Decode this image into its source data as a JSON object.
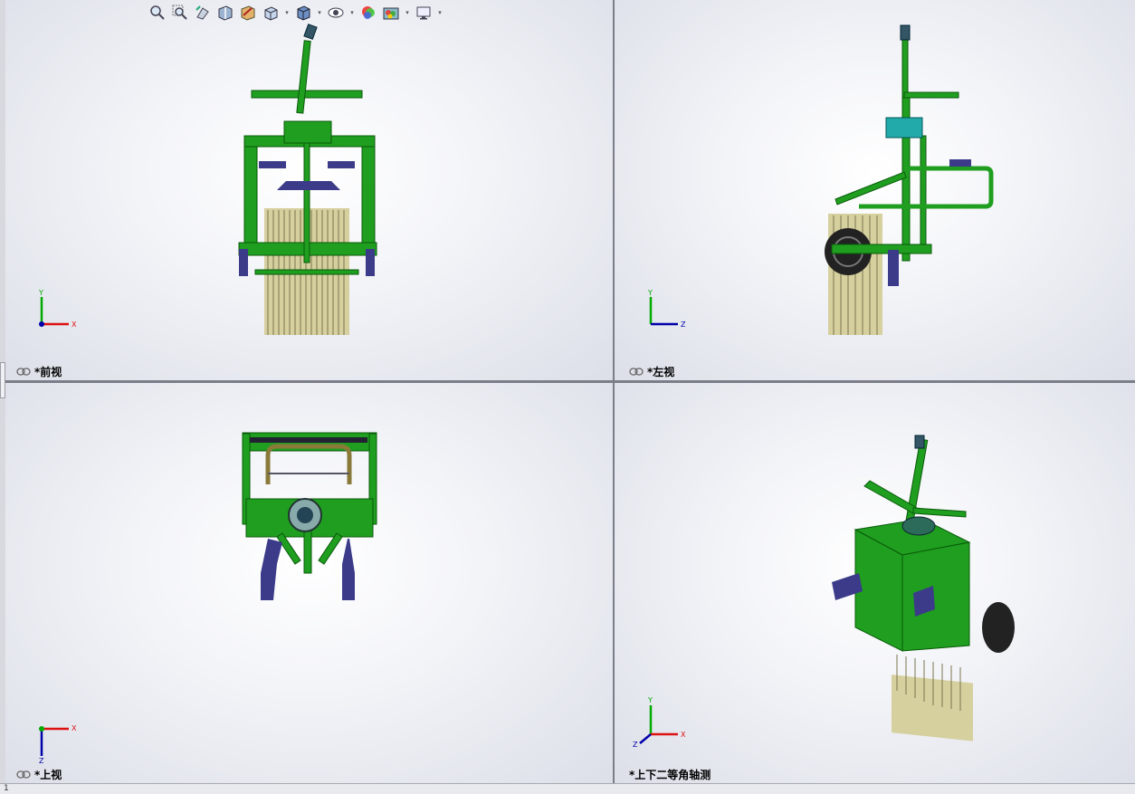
{
  "app": {
    "name": "SolidWorks four-view window"
  },
  "viewports": [
    {
      "id": "front",
      "label": "*前视",
      "axes": {
        "horizontal": "X",
        "vertical": "Y"
      }
    },
    {
      "id": "left",
      "label": "*左视",
      "axes": {
        "horizontal": "Z",
        "vertical": "Y"
      }
    },
    {
      "id": "top",
      "label": "*上视",
      "axes": {
        "horizontal": "X",
        "vertical": "Z"
      }
    },
    {
      "id": "iso",
      "label": "*上下二等角轴测",
      "axes": {
        "a": "Y",
        "b": "X",
        "c": "Z"
      }
    }
  ],
  "heads_up_toolbar": [
    {
      "icon": "zoom-to-fit-icon"
    },
    {
      "icon": "zoom-to-area-icon"
    },
    {
      "icon": "previous-view-icon"
    },
    {
      "icon": "section-view-icon"
    },
    {
      "icon": "dynamic-annotation-views-icon"
    },
    {
      "icon": "view-orientation-icon",
      "dropdown": true
    },
    {
      "icon": "display-style-icon",
      "dropdown": true
    },
    {
      "icon": "hide-show-items-icon",
      "dropdown": true
    },
    {
      "icon": "edit-appearance-icon"
    },
    {
      "icon": "apply-scene-icon",
      "dropdown": true
    },
    {
      "icon": "view-settings-icon",
      "dropdown": true
    }
  ],
  "status_bar": {
    "left_text": "1"
  },
  "colors": {
    "frame_green": "#1f9e1f",
    "dark_green": "#0a5a0a",
    "bracket_blue": "#3b3b8a",
    "tine_beige": "#d6cf9e",
    "axis_red": "#d11",
    "axis_green": "#0a0",
    "axis_blue": "#00a"
  }
}
